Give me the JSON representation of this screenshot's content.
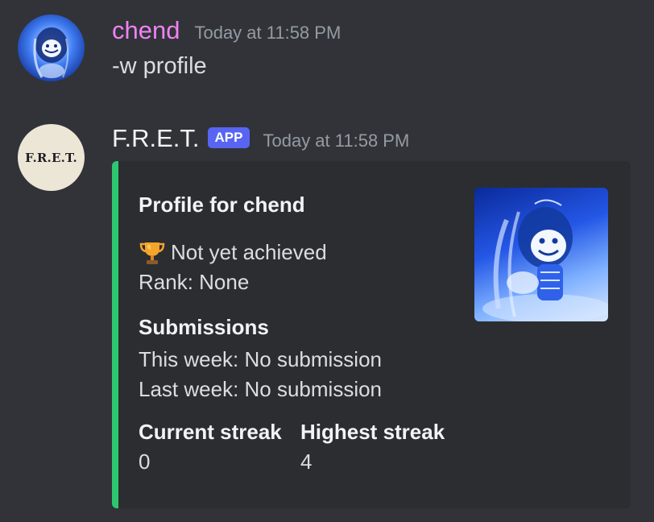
{
  "messages": [
    {
      "username": "chend",
      "timestamp": "Today at 11:58 PM",
      "content": "-w profile"
    },
    {
      "username": "F.R.E.T.",
      "badge": "APP",
      "timestamp": "Today at 11:58 PM",
      "avatar_text": "F.R.E.T.",
      "embed": {
        "accent_color": "#2dc770",
        "title": "Profile for chend",
        "achievement_icon": "trophy-icon",
        "achievement": "Not yet achieved",
        "rank": "Rank: None",
        "submissions_heading": "Submissions",
        "this_week": "This week: No submission",
        "last_week": "Last week: No submission",
        "fields": [
          {
            "name": "Current streak",
            "value": "0"
          },
          {
            "name": "Highest streak",
            "value": "4"
          }
        ]
      }
    }
  ],
  "colors": {
    "background": "#313338",
    "embed_background": "#2b2d31",
    "user_name": "#ee83f2",
    "app_badge": "#5865f2",
    "timestamp": "#949ba4"
  }
}
